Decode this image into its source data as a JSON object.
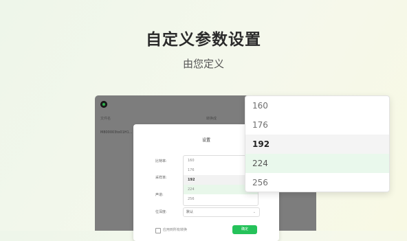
{
  "hero": {
    "title": "自定义参数设置",
    "subtitle": "由您定义"
  },
  "app": {
    "columns": [
      "文件名",
      "转换成"
    ],
    "file_name": "M800003to01H1..."
  },
  "dialog": {
    "title": "设置",
    "labels": {
      "bitrate": "比特率:",
      "samplerate": "采样率:",
      "channels": "声道:",
      "bitdepth": "位深度:"
    },
    "options": [
      "160",
      "176",
      "192",
      "224",
      "256"
    ],
    "selected_option": "192",
    "hovered_option": "224",
    "bitdepth_value": "默认",
    "checkbox_label": "应用到所有转换",
    "ok_label": "确定"
  },
  "dropdown": {
    "options": [
      "160",
      "176",
      "192",
      "224",
      "256"
    ],
    "selected": "192",
    "hovered": "224"
  },
  "colors": {
    "accent_green": "#25c25a",
    "hover_green": "#e9f8ec",
    "overlay_gray": "#7d7d7d"
  }
}
